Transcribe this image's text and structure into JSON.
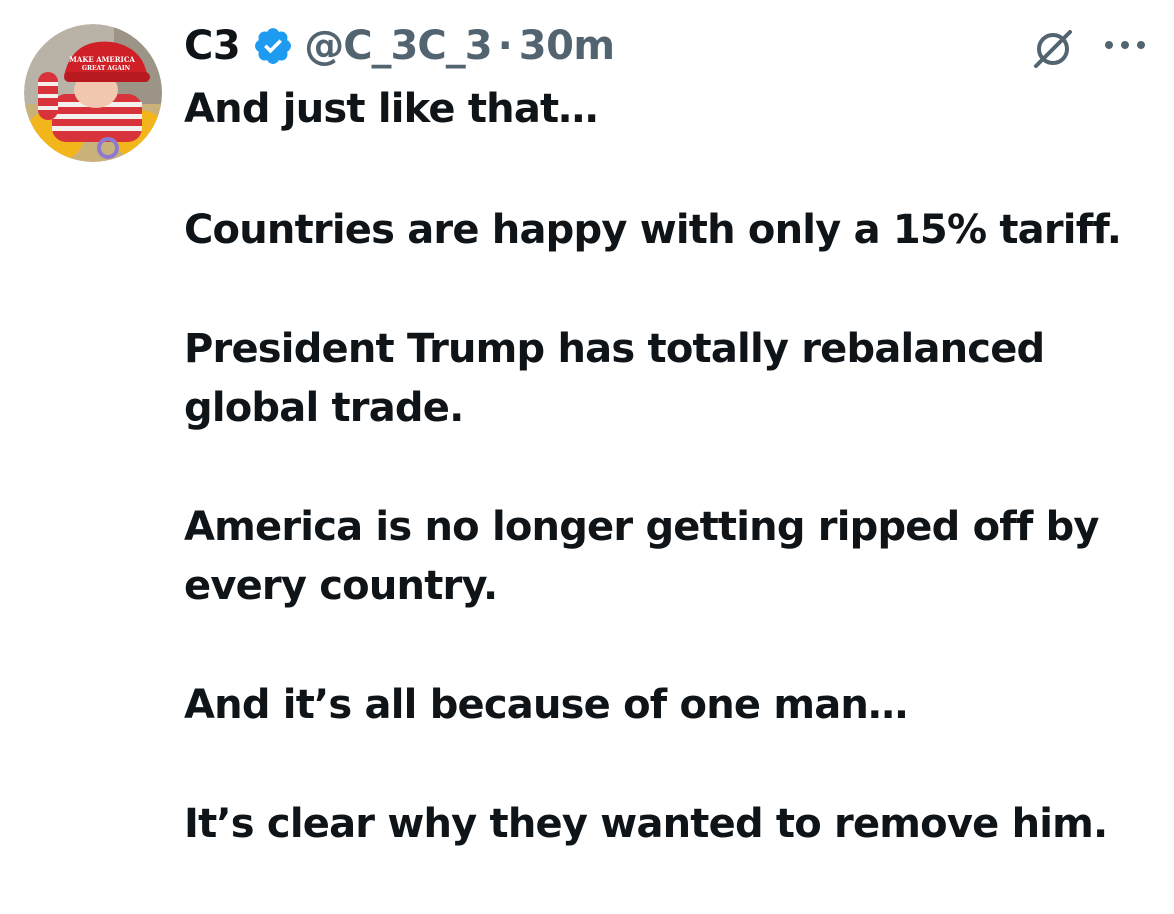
{
  "tweet": {
    "author": {
      "display_name": "C3",
      "verified_icon": "verified-badge-icon",
      "handle": "@C_3C_3",
      "separator": "·",
      "time": "30m",
      "avatar": "profile-avatar-child-in-red-cap"
    },
    "actions": {
      "grok_icon": "grok-icon",
      "more_icon": "more-options-icon"
    },
    "paragraphs": [
      "And just like that…",
      "Countries are happy with only a 15% tariff.",
      "President Trump has totally rebalanced global trade.",
      "America is no longer getting ripped off by every country.",
      "And it’s all because of one man…",
      "It’s clear why they wanted to remove him."
    ]
  },
  "colors": {
    "text_primary": "#0f1419",
    "text_secondary": "#536471",
    "verified_blue": "#1d9bf0",
    "background": "#ffffff"
  }
}
